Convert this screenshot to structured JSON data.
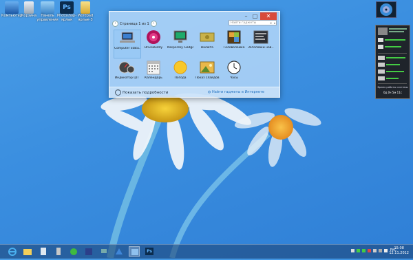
{
  "desktop": {
    "icons": [
      {
        "label": "Компьютер",
        "icon": "computer-icon"
      },
      {
        "label": "Корзина",
        "icon": "recycle-bin-icon"
      },
      {
        "label": "Панель управления",
        "icon": "control-panel-icon"
      },
      {
        "label": "Photoshop-ярлык",
        "icon": "photoshop-icon"
      },
      {
        "label": "Wordpad ярлык-3",
        "icon": "folder-icon"
      }
    ]
  },
  "gallery": {
    "pager": "Страница 1 из 1",
    "search_placeholder": "Найти гаджеты",
    "close": "✕",
    "min": "–",
    "max": "□",
    "items": [
      {
        "label": "Computer Statu...",
        "icon": "laptop-icon"
      },
      {
        "label": "DriveBuddy",
        "icon": "disc-icon"
      },
      {
        "label": "Kaspersky Gadget",
        "icon": "monitor-icon"
      },
      {
        "label": "Валюта",
        "icon": "currency-icon"
      },
      {
        "label": "Головоломка",
        "icon": "puzzle-icon"
      },
      {
        "label": "Заголовки нов...",
        "icon": "headlines-icon"
      },
      {
        "label": "Индикатор ЦП",
        "icon": "cpu-meter-icon"
      },
      {
        "label": "Календарь",
        "icon": "calendar-icon"
      },
      {
        "label": "Погода",
        "icon": "weather-icon"
      },
      {
        "label": "Показ слайдов",
        "icon": "slideshow-icon"
      },
      {
        "label": "Часы",
        "icon": "clock-icon"
      }
    ],
    "details": "Показать подробности",
    "online": "Найти гаджеты в Интернете"
  },
  "sidebar_gadget": {
    "footer": "Время работы системы",
    "uptime": "0д 0ч 5м 11с"
  },
  "tray": {
    "lang": "РУС",
    "time": "15:08",
    "date": "12.11.2012"
  },
  "colors": {
    "accent": "#3b8fe0",
    "close": "#d84a3a"
  }
}
